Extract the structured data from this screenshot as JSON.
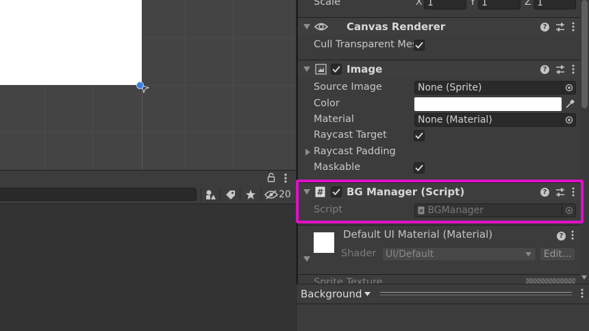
{
  "transform": {
    "scale_label": "Scale",
    "x_label": "X",
    "x_value": "1",
    "y_label": "Y",
    "y_value": "1",
    "z_label": "Z",
    "z_value": "1"
  },
  "canvas_renderer": {
    "title": "Canvas Renderer",
    "cull_label": "Cull Transparent Mes",
    "cull_checked": true
  },
  "image": {
    "title": "Image",
    "source_image_label": "Source Image",
    "source_image_value": "None (Sprite)",
    "color_label": "Color",
    "color_value": "#ffffff",
    "material_label": "Material",
    "material_value": "None (Material)",
    "raycast_target_label": "Raycast Target",
    "raycast_padding_label": "Raycast Padding",
    "maskable_label": "Maskable"
  },
  "bg_manager": {
    "title": "BG Manager (Script)",
    "script_label": "Script",
    "script_value": "BGManager"
  },
  "material_preview": {
    "title": "Default UI Material (Material)",
    "shader_label": "Shader",
    "shader_value": "UI/Default",
    "edit_label": "Edit..."
  },
  "sprite_texture_label": "Sprite Texture",
  "bottom_bar": {
    "dropdown_label": "Background"
  },
  "project_toolbar": {
    "hidden_count": "20"
  },
  "colors": {
    "highlight": "#e010c8",
    "accent_pivot": "#3e7ddc"
  }
}
